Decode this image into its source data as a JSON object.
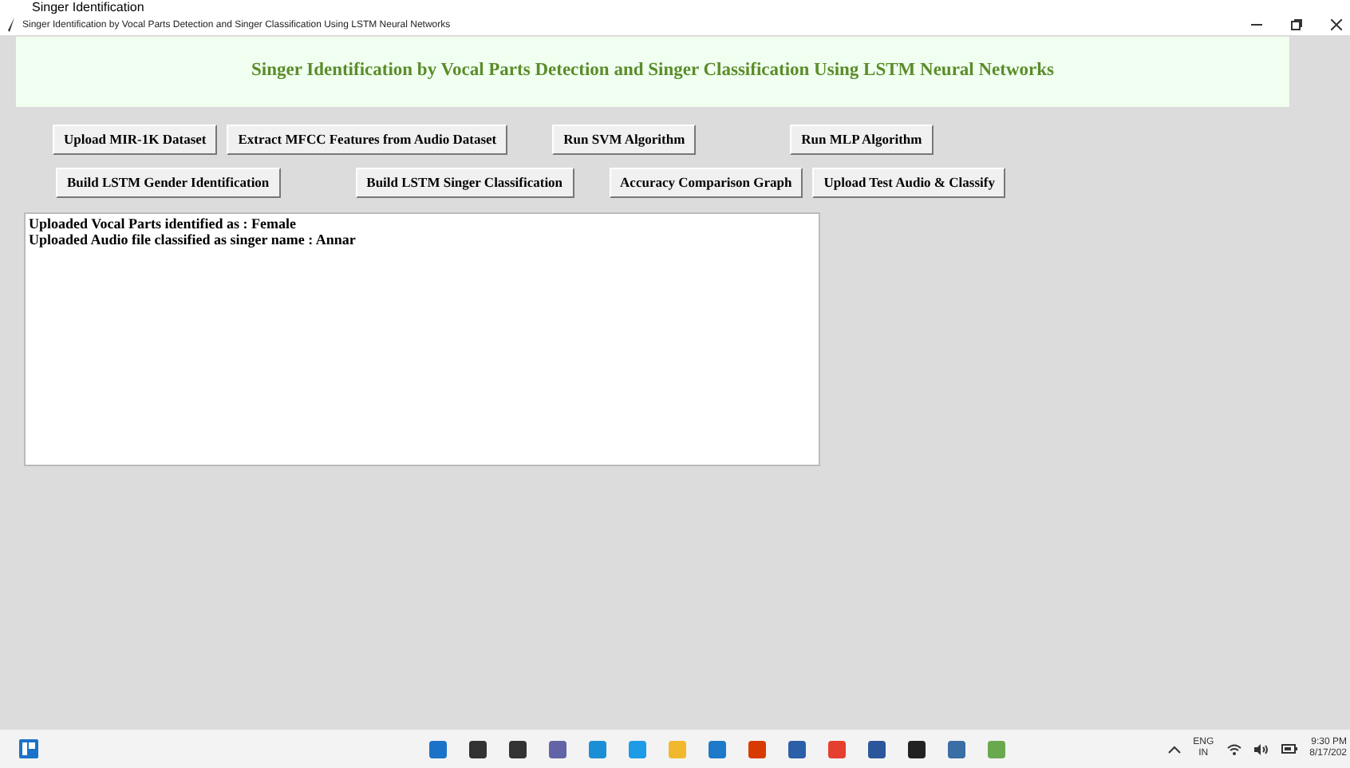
{
  "overlay_text": "Singer Identification",
  "window": {
    "title": "Singer Identification by Vocal Parts Detection and Singer Classification Using LSTM Neural Networks"
  },
  "heading": "Singer Identification by Vocal Parts Detection and Singer Classification Using LSTM Neural Networks",
  "button_rows": [
    {
      "buttons": [
        {
          "label": "Upload MIR-1K Dataset"
        },
        {
          "label": "Extract MFCC Features from Audio Dataset"
        },
        {
          "label": "Run SVM Algorithm"
        },
        {
          "label": "Run MLP Algorithm"
        }
      ]
    },
    {
      "buttons": [
        {
          "label": "Build LSTM Gender Identification"
        },
        {
          "label": "Build LSTM Singer Classification"
        },
        {
          "label": "Accuracy Comparison Graph"
        },
        {
          "label": "Upload Test Audio & Classify"
        }
      ]
    }
  ],
  "output_lines": [
    "Uploaded Vocal Parts identified as : Female",
    "Uploaded Audio file classified as singer name : Annar"
  ],
  "taskbar": {
    "language": "ENG",
    "region": "IN",
    "time": "9:30 PM",
    "date": "8/17/202"
  }
}
